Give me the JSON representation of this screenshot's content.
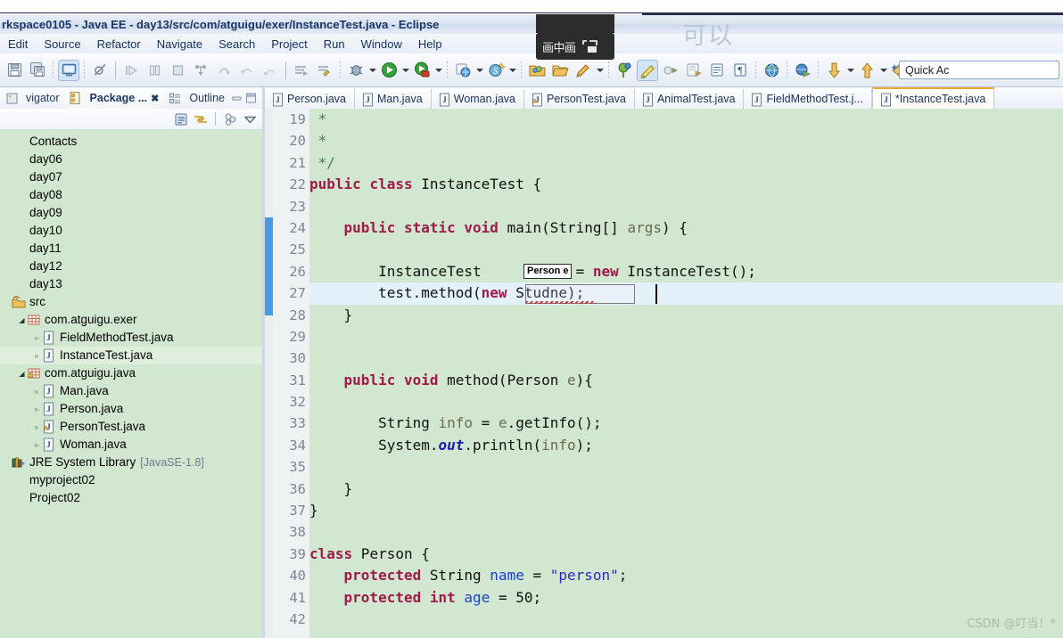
{
  "window": {
    "title": "rkspace0105 - Java EE - day13/src/com/atguigu/exer/InstanceTest.java - Eclipse"
  },
  "menu": {
    "items": [
      "Edit",
      "Source",
      "Refactor",
      "Navigate",
      "Search",
      "Project",
      "Run",
      "Window",
      "Help"
    ]
  },
  "toolbar": {
    "quick_access_placeholder": "Quick Ac",
    "icons": [
      "save-icon",
      "save-all-icon",
      "new-java-class-icon",
      "toggle-breakpoint-icon",
      "resume-icon",
      "suspend-icon",
      "terminate-icon",
      "step-into-icon",
      "step-over-icon",
      "step-return-icon",
      "drop-to-frame-icon",
      "open-type-icon",
      "open-task-icon",
      "debug-icon",
      "run-icon",
      "run-coverage-icon",
      "external-tools-icon",
      "search-icon",
      "new-folder-icon",
      "open-folder-icon",
      "annotation-icon",
      "marker-icon",
      "pencil-icon",
      "next-annotation-icon",
      "previous-edit-icon",
      "last-edit-icon",
      "show-whitespace-icon",
      "globe-icon",
      "link-icon",
      "down-arrow-icon",
      "up-arrow-icon",
      "back-icon",
      "forward-arrow-icon"
    ]
  },
  "pip": {
    "label": "画中画",
    "icon": "picture-in-picture-icon"
  },
  "annotation_text": "可以",
  "watermark": "CSDN @叮当！*",
  "left_panel": {
    "tabs": [
      {
        "label": "vigator",
        "icon": "navigator-icon",
        "active": false
      },
      {
        "label": "Package ...",
        "icon": "package-explorer-icon",
        "active": true
      },
      {
        "label": "Outline",
        "icon": "outline-icon",
        "active": false
      }
    ],
    "tab_close_icon": "close-icon",
    "view_tools": [
      "collapse-all-icon",
      "link-with-editor-icon",
      "view-menu-icon",
      "chevron-down-icon"
    ],
    "min_icon": "minimize-icon",
    "max_icon": "maximize-icon",
    "tree": [
      {
        "label": "Contacts",
        "indent": 0,
        "arrow": "",
        "icon": "project-icon",
        "selected": false
      },
      {
        "label": "day06",
        "indent": 0,
        "arrow": "",
        "icon": "project-icon",
        "selected": false
      },
      {
        "label": "day07",
        "indent": 0,
        "arrow": "",
        "icon": "project-icon",
        "selected": false
      },
      {
        "label": "day08",
        "indent": 0,
        "arrow": "",
        "icon": "project-icon",
        "selected": false
      },
      {
        "label": "day09",
        "indent": 0,
        "arrow": "",
        "icon": "project-icon",
        "selected": false
      },
      {
        "label": "day10",
        "indent": 0,
        "arrow": "",
        "icon": "project-icon",
        "selected": false
      },
      {
        "label": "day11",
        "indent": 0,
        "arrow": "",
        "icon": "project-icon",
        "selected": false
      },
      {
        "label": "day12",
        "indent": 0,
        "arrow": "",
        "icon": "project-icon",
        "selected": false
      },
      {
        "label": "day13",
        "indent": 0,
        "arrow": "",
        "icon": "project-icon",
        "selected": false
      },
      {
        "label": "src",
        "indent": 0,
        "arrow": "",
        "icon": "source-folder-icon",
        "selected": false
      },
      {
        "label": "com.atguigu.exer",
        "indent": 1,
        "arrow": "open",
        "icon": "package-icon",
        "selected": false
      },
      {
        "label": "FieldMethodTest.java",
        "indent": 2,
        "arrow": "closed",
        "icon": "java-file-icon",
        "selected": false
      },
      {
        "label": "InstanceTest.java",
        "indent": 2,
        "arrow": "closed",
        "icon": "java-file-icon",
        "selected": true
      },
      {
        "label": "com.atguigu.java",
        "indent": 1,
        "arrow": "open",
        "icon": "package-warning-icon",
        "selected": false
      },
      {
        "label": "Man.java",
        "indent": 2,
        "arrow": "closed",
        "icon": "java-file-icon",
        "selected": false
      },
      {
        "label": "Person.java",
        "indent": 2,
        "arrow": "closed",
        "icon": "java-file-icon",
        "selected": false
      },
      {
        "label": "PersonTest.java",
        "indent": 2,
        "arrow": "closed",
        "icon": "java-file-warning-icon",
        "selected": false
      },
      {
        "label": "Woman.java",
        "indent": 2,
        "arrow": "closed",
        "icon": "java-file-icon",
        "selected": false
      },
      {
        "label": "JRE System Library",
        "suffix": "[JavaSE-1.8]",
        "indent": 0,
        "arrow": "",
        "icon": "library-icon",
        "selected": false
      },
      {
        "label": "myproject02",
        "indent": 0,
        "arrow": "",
        "icon": "project-icon",
        "selected": false
      },
      {
        "label": "Project02",
        "indent": 0,
        "arrow": "",
        "icon": "project-icon",
        "selected": false
      }
    ]
  },
  "editor": {
    "tabs": [
      {
        "label": "Person.java",
        "icon": "java-file-icon",
        "active": false
      },
      {
        "label": "Man.java",
        "icon": "java-file-icon",
        "active": false
      },
      {
        "label": "Woman.java",
        "icon": "java-file-icon",
        "active": false
      },
      {
        "label": "PersonTest.java",
        "icon": "java-file-warning-icon",
        "active": false
      },
      {
        "label": "AnimalTest.java",
        "icon": "java-file-icon",
        "active": false
      },
      {
        "label": "FieldMethodTest.j...",
        "icon": "java-file-icon",
        "active": false
      },
      {
        "label": "*InstanceTest.java",
        "icon": "java-file-icon",
        "active": true
      }
    ],
    "param_tooltip": "Person e",
    "first_line_number": 19,
    "error_line": 27,
    "error_icon": "error-marker-icon",
    "lines": [
      {
        "n": 19,
        "tokens": [
          {
            "t": " *",
            "c": "cm"
          }
        ]
      },
      {
        "n": 20,
        "tokens": [
          {
            "t": " *",
            "c": "cm"
          }
        ]
      },
      {
        "n": 21,
        "tokens": [
          {
            "t": " */",
            "c": "cm"
          }
        ]
      },
      {
        "n": 22,
        "tokens": [
          {
            "t": "public",
            "c": "kw"
          },
          {
            "t": " ",
            "c": "pl"
          },
          {
            "t": "class",
            "c": "kw"
          },
          {
            "t": " InstanceTest {",
            "c": "pl"
          }
        ]
      },
      {
        "n": 23,
        "tokens": []
      },
      {
        "n": 24,
        "fold": true,
        "tokens": [
          {
            "t": "    ",
            "c": "pl"
          },
          {
            "t": "public",
            "c": "kw"
          },
          {
            "t": " ",
            "c": "pl"
          },
          {
            "t": "static",
            "c": "kw"
          },
          {
            "t": " ",
            "c": "pl"
          },
          {
            "t": "void",
            "c": "kw"
          },
          {
            "t": " main(String[] ",
            "c": "pl"
          },
          {
            "t": "args",
            "c": "lv"
          },
          {
            "t": ") {",
            "c": "pl"
          }
        ]
      },
      {
        "n": 25,
        "tokens": []
      },
      {
        "n": 26,
        "tokens": [
          {
            "t": "        InstanceTest",
            "c": "pl"
          },
          {
            "t": "          ",
            "c": "pl"
          },
          {
            "t": " = ",
            "c": "pl"
          },
          {
            "t": "new",
            "c": "kw"
          },
          {
            "t": " InstanceTest();",
            "c": "pl"
          }
        ]
      },
      {
        "n": 27,
        "highlight": true,
        "tokens": [
          {
            "t": "        test.method(",
            "c": "pl"
          },
          {
            "t": "new",
            "c": "kw"
          },
          {
            "t": " Studne);",
            "c": "pl"
          }
        ]
      },
      {
        "n": 28,
        "tokens": [
          {
            "t": "    }",
            "c": "pl"
          }
        ]
      },
      {
        "n": 29,
        "tokens": []
      },
      {
        "n": 30,
        "tokens": []
      },
      {
        "n": 31,
        "fold": true,
        "tokens": [
          {
            "t": "    ",
            "c": "pl"
          },
          {
            "t": "public",
            "c": "kw"
          },
          {
            "t": " ",
            "c": "pl"
          },
          {
            "t": "void",
            "c": "kw"
          },
          {
            "t": " method(Person ",
            "c": "pl"
          },
          {
            "t": "e",
            "c": "lv"
          },
          {
            "t": "){",
            "c": "pl"
          }
        ]
      },
      {
        "n": 32,
        "tokens": []
      },
      {
        "n": 33,
        "tokens": [
          {
            "t": "        String ",
            "c": "pl"
          },
          {
            "t": "info",
            "c": "lv"
          },
          {
            "t": " = ",
            "c": "pl"
          },
          {
            "t": "e",
            "c": "lv"
          },
          {
            "t": ".getInfo();",
            "c": "pl"
          }
        ]
      },
      {
        "n": 34,
        "tokens": [
          {
            "t": "        System.",
            "c": "pl"
          },
          {
            "t": "out",
            "c": "stat"
          },
          {
            "t": ".println(",
            "c": "pl"
          },
          {
            "t": "info",
            "c": "lv"
          },
          {
            "t": ");",
            "c": "pl"
          }
        ]
      },
      {
        "n": 35,
        "tokens": []
      },
      {
        "n": 36,
        "tokens": [
          {
            "t": "    }",
            "c": "pl"
          }
        ]
      },
      {
        "n": 37,
        "tokens": [
          {
            "t": "}",
            "c": "pl"
          }
        ]
      },
      {
        "n": 38,
        "tokens": []
      },
      {
        "n": 39,
        "tokens": [
          {
            "t": "class",
            "c": "kw"
          },
          {
            "t": " Person {",
            "c": "pl"
          }
        ]
      },
      {
        "n": 40,
        "tokens": [
          {
            "t": "    ",
            "c": "pl"
          },
          {
            "t": "protected",
            "c": "kw"
          },
          {
            "t": " String ",
            "c": "pl"
          },
          {
            "t": "name",
            "c": "fld"
          },
          {
            "t": " = ",
            "c": "pl"
          },
          {
            "t": "\"person\"",
            "c": "str"
          },
          {
            "t": ";",
            "c": "pl"
          }
        ]
      },
      {
        "n": 41,
        "tokens": [
          {
            "t": "    ",
            "c": "pl"
          },
          {
            "t": "protected",
            "c": "kw"
          },
          {
            "t": " ",
            "c": "pl"
          },
          {
            "t": "int",
            "c": "kw"
          },
          {
            "t": " ",
            "c": "pl"
          },
          {
            "t": "age",
            "c": "fld"
          },
          {
            "t": " = ",
            "c": "pl"
          },
          {
            "t": "50",
            "c": "pl"
          },
          {
            "t": ";",
            "c": "pl"
          }
        ]
      },
      {
        "n": 42,
        "tokens": []
      }
    ]
  },
  "colors": {
    "editor_bg": "#d2e7d0",
    "highlight_line": "#e4f0fa",
    "keyword": "#9e1a4a",
    "string": "#2a2ac0",
    "comment": "#3f7f5f",
    "field": "#1c3fd0",
    "error": "#cf2a27",
    "change_bar": "#4a9ae0"
  }
}
